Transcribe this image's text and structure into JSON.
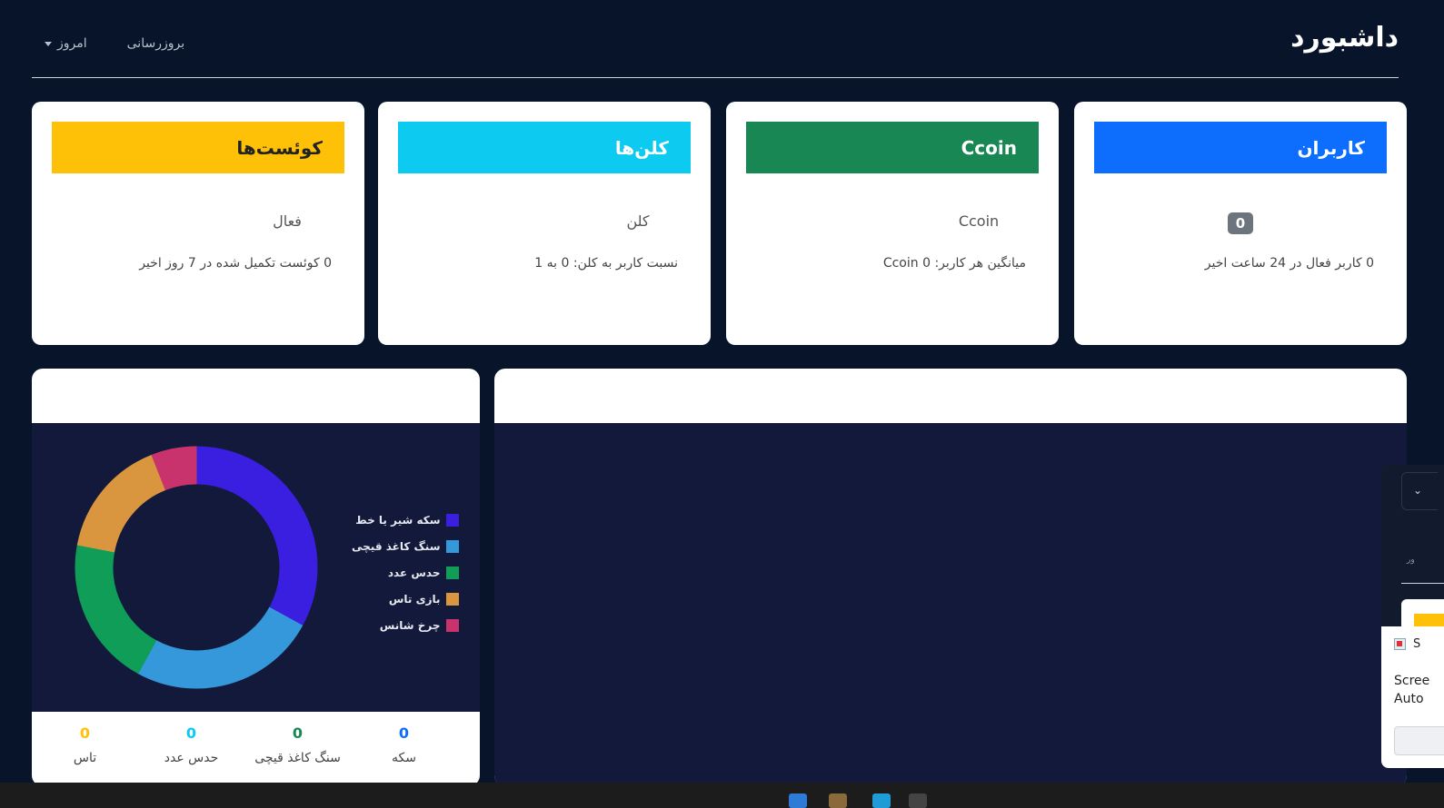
{
  "header": {
    "title": "داشبورد",
    "refresh_label": "بروزرسانی",
    "range_label": "امروز"
  },
  "cards": [
    {
      "title": "کاربران",
      "color": "#0d6efd",
      "value": "0",
      "desc": "0 کاربر فعال در 24 ساعت اخیر"
    },
    {
      "title": "Ccoin",
      "color": "#198754",
      "value": "Ccoin",
      "desc": "میانگین هر کاربر: 0 Ccoin"
    },
    {
      "title": "کلن‌ها",
      "color": "#0dcaf0",
      "value": "کلن",
      "desc": "نسبت کاربر به کلن: 0 به 1"
    },
    {
      "title": "کوئست‌ها",
      "color": "#ffc107",
      "value": "فعال",
      "desc": "0 کوئست تکمیل شده در 7 روز اخیر"
    }
  ],
  "chart_data": {
    "type": "pie",
    "categories": [
      "سکه شیر یا خط",
      "سنگ کاغذ قیچی",
      "حدس عدد",
      "بازی تاس",
      "چرخ شانس"
    ],
    "values": [
      33,
      25,
      20,
      16,
      6
    ],
    "colors": [
      "#3b1fe0",
      "#3498db",
      "#0f9d58",
      "#d9963f",
      "#c9336d"
    ],
    "legend_position": "right",
    "donut": true
  },
  "stats": [
    {
      "value": "0",
      "label": "تاس",
      "color": "#ffc107"
    },
    {
      "value": "0",
      "label": "حدس عدد",
      "color": "#0dcaf0"
    },
    {
      "value": "0",
      "label": "سنگ کاغذ قیچی",
      "color": "#198754"
    },
    {
      "value": "0",
      "label": "سکه",
      "color": "#0d6efd"
    }
  ],
  "popup": {
    "app_label": "S",
    "line1": "Scree",
    "line2": "Auto",
    "mini_select": "ور"
  }
}
